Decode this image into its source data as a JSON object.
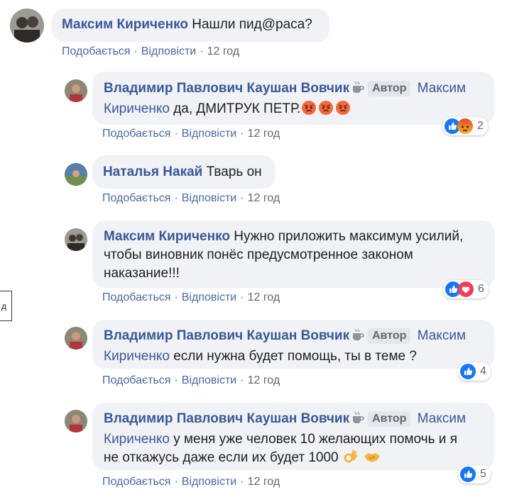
{
  "labels": {
    "like": "Подобається",
    "reply": "Відповісти",
    "author_badge": "Автор",
    "sep": "·"
  },
  "left_fragment": "д",
  "comments": [
    {
      "author": "Максим Кириченко",
      "text": "Нашли пид@раса?",
      "time": "12 год"
    },
    {
      "author": "Владимир Павлович Каушан Вовчик",
      "mention": "Максим Кириченко",
      "text": "да, ДМИТРУК ПЕТР.",
      "time": "12 год",
      "reactions": {
        "icons": [
          "like",
          "angry"
        ],
        "count": "2"
      },
      "emoji_count": 3,
      "emoji": "angry-face"
    },
    {
      "author": "Наталья Накай",
      "text": "Тварь он",
      "time": "12 год"
    },
    {
      "author": "Максим Кириченко",
      "text_lines": [
        "Нужно приложить максимум усилий,",
        "чтобы виновник понёс предусмотренное законом",
        "наказание!!!"
      ],
      "time": "12 год",
      "reactions": {
        "icons": [
          "like",
          "love"
        ],
        "count": "6"
      }
    },
    {
      "author": "Владимир Павлович Каушан Вовчик",
      "mention_part1": "Максим",
      "mention_part2": "Кириченко",
      "text": "если нужна будет помощь, ты в теме ?",
      "time": "12 год",
      "reactions": {
        "icons": [
          "like"
        ],
        "count": "4"
      }
    },
    {
      "author": "Владимир Павлович Каушан Вовчик",
      "mention_part1": "Максим",
      "mention_part2": "Кириченко",
      "text_line1": "у меня уже человек 10 желающих помочь и я",
      "text_line2": "не откажусь даже если их будет 1000",
      "time": "12 год",
      "reactions": {
        "icons": [
          "like"
        ],
        "count": "5"
      },
      "emojis": [
        "ok-hand",
        "handshake"
      ]
    }
  ],
  "colors": {
    "link": "#385898",
    "bubble": "#f0f2f5",
    "like": "#1877f2",
    "love": "#f33e58",
    "angry": "#e9710f"
  }
}
